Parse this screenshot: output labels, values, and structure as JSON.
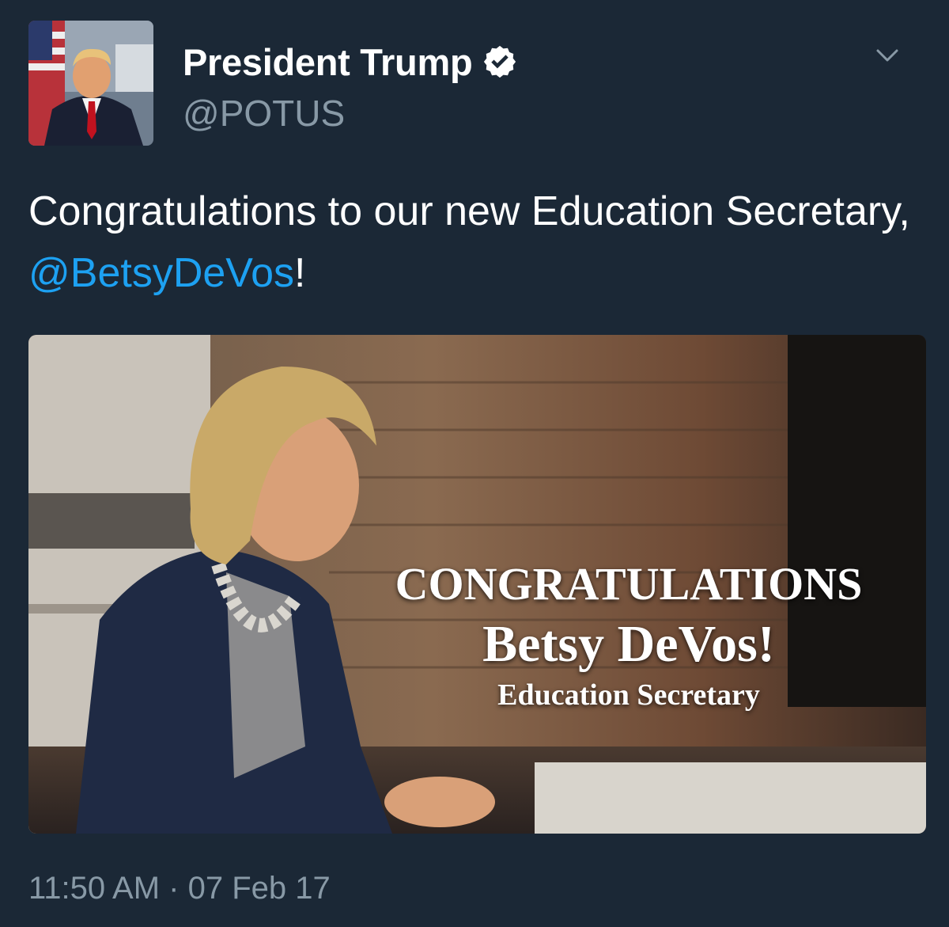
{
  "author": {
    "display_name": "President Trump",
    "handle": "@POTUS",
    "verified": true,
    "avatar_icon": "profile-photo"
  },
  "menu": {
    "icon": "chevron-down-icon"
  },
  "tweet": {
    "text_before": "Congratulations to our new Education Secretary, ",
    "mention": "@BetsyDeVos",
    "text_after": "!"
  },
  "media": {
    "headline": "CONGRATULATIONS",
    "name": "Betsy DeVos!",
    "subtitle": "Education Secretary"
  },
  "footer": {
    "timestamp": "11:50 AM · 07 Feb 17"
  },
  "colors": {
    "background": "#1b2836",
    "link": "#1da1f2",
    "secondary_text": "#8899a6"
  }
}
